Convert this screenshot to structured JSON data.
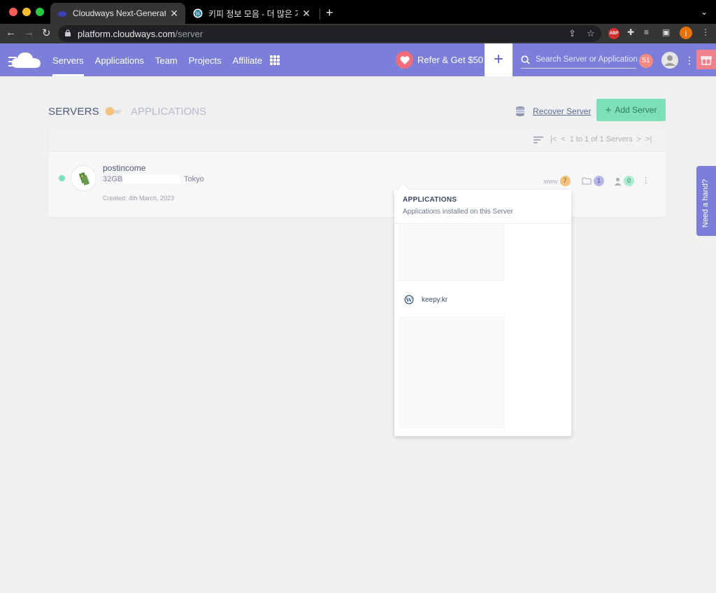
{
  "browser": {
    "tabs": [
      {
        "title": "Cloudways Next-Generation Cl",
        "active": true
      },
      {
        "title": "키피 정보 모음 - 더 많은 가치를 추구",
        "active": false
      }
    ],
    "url_host": "platform.cloudways.com",
    "url_path": "/server",
    "profile_initial": "j",
    "abp_label": "ABP"
  },
  "header": {
    "nav": [
      "Servers",
      "Applications",
      "Team",
      "Projects",
      "Affiliate"
    ],
    "active_nav": "Servers",
    "refer_label": "Refer & Get $50",
    "add_label": "+",
    "search_placeholder": "Search Server or Application",
    "notifications": "51"
  },
  "page": {
    "servers_label": "SERVERS",
    "applications_label": "APPLICATIONS",
    "recover_label": "Recover Server",
    "add_server_label": "Add Server",
    "pager_text": "1 to 1 of 1 Servers"
  },
  "server": {
    "name": "postincome",
    "spec": "32GB",
    "location": "Tokyo",
    "created": "Created: 4th March, 2023",
    "www_label": "www",
    "apps_count": "7",
    "projects_count": "1",
    "team_count": "0"
  },
  "popover": {
    "title": "APPLICATIONS",
    "subtitle": "Applications installed on this Server",
    "apps": [
      "keepy.kr"
    ]
  },
  "help": {
    "label": "Need a hand?"
  },
  "colors": {
    "brand": "#7b7fd9",
    "accent_green": "#7ee0b8",
    "badge": "#f58a82"
  }
}
